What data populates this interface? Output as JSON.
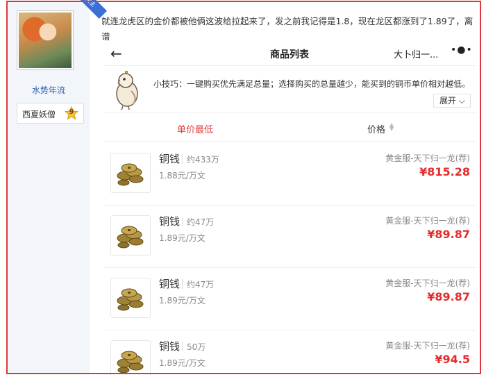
{
  "user": {
    "corner_badge": "楼主",
    "username": "水势年流",
    "title": "西夏妖僧",
    "level": "9"
  },
  "post": {
    "text": "就连龙虎区的金价都被他俩这波给拉起来了，发之前我记得是1.8，现在龙区都涨到了1.89了，离谱"
  },
  "app": {
    "nav_title": "商品列表",
    "nav_right_label": "大卜归一...",
    "nav_dots": "•●•",
    "tip_text": "小技巧：一键购买优先满足总量；选择购买的总量越少，能买到的铜币单价相对越低。",
    "expand_label": "展开",
    "sort_unit_label": "单价最低",
    "sort_price_label": "价格",
    "items": [
      {
        "name": "铜钱",
        "qty": "约433万",
        "unit_price": "1.88元/万文",
        "server": "黄金服-天下归一龙(荐)",
        "price": "¥815.28"
      },
      {
        "name": "铜钱",
        "qty": "约47万",
        "unit_price": "1.89元/万文",
        "server": "黄金服-天下归一龙(荐)",
        "price": "¥89.87"
      },
      {
        "name": "铜钱",
        "qty": "约47万",
        "unit_price": "1.89元/万文",
        "server": "黄金服-天下归一龙(荐)",
        "price": "¥89.87"
      },
      {
        "name": "铜钱",
        "qty": "50万",
        "unit_price": "1.89元/万文",
        "server": "黄金服-天下归一龙(荐)",
        "price": "¥94.5"
      }
    ]
  },
  "colors": {
    "frame": "#e0383a",
    "price": "#e52b2b",
    "link": "#2e5fb4",
    "ribbon": "#3a6fd8"
  }
}
